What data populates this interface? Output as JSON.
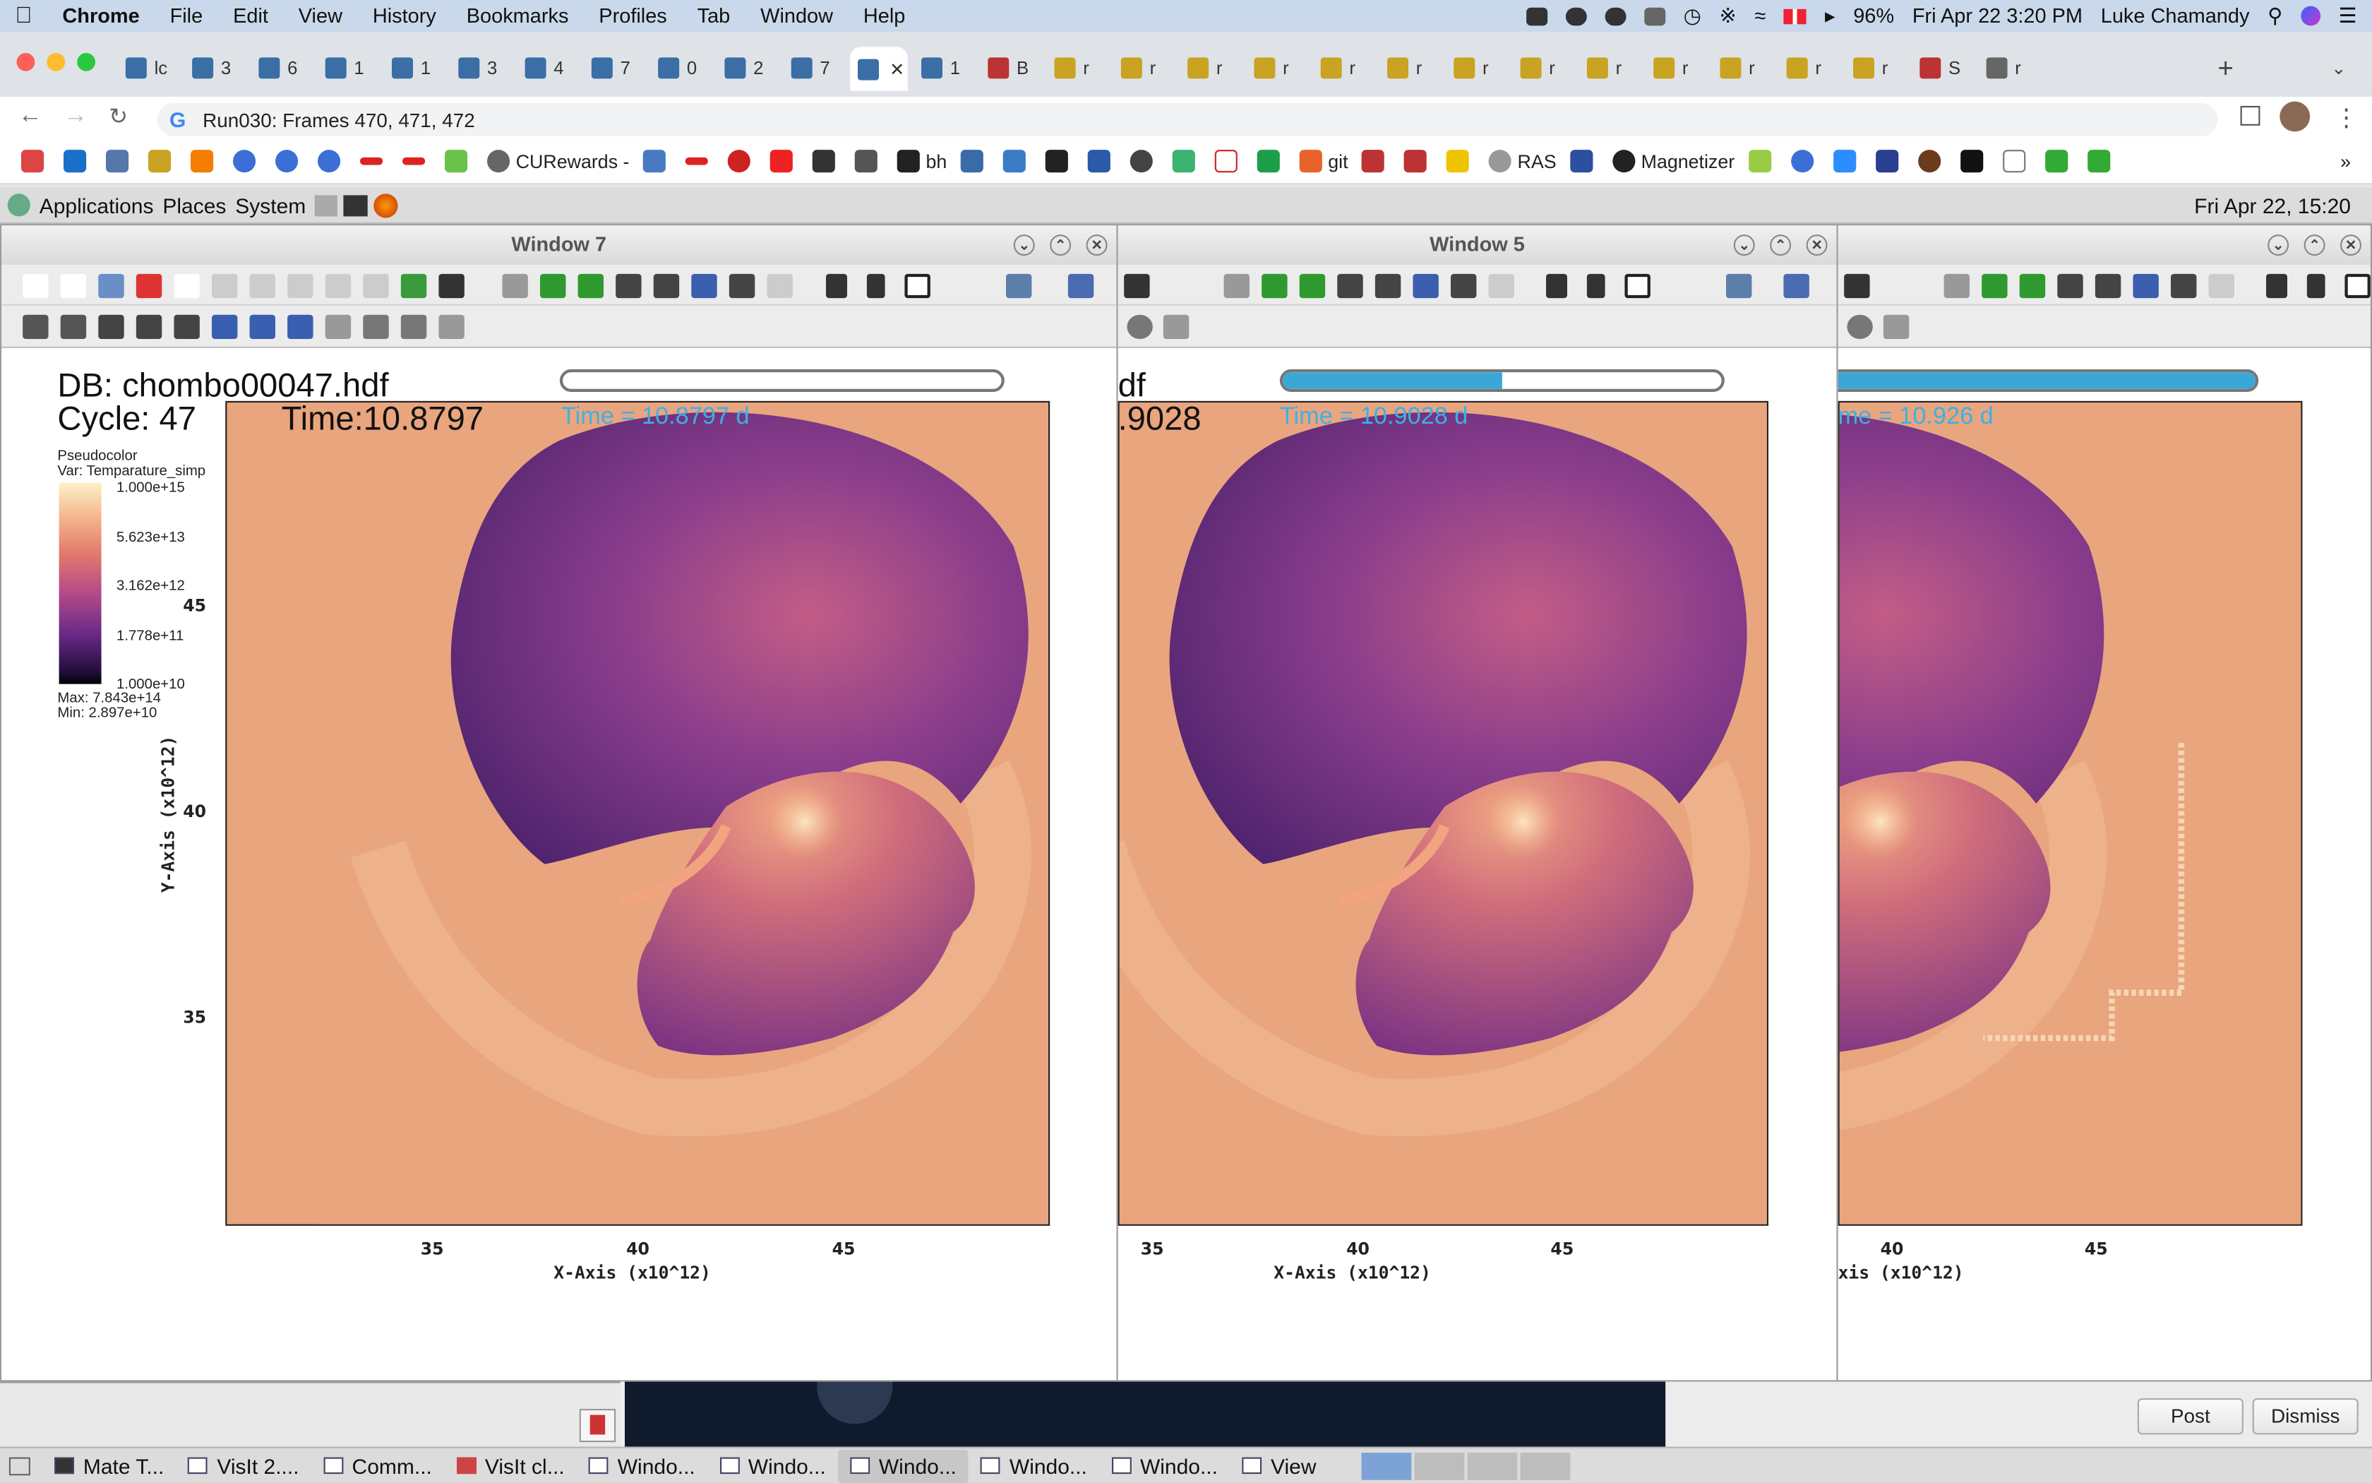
{
  "menubar": {
    "app": "Chrome",
    "items": [
      "File",
      "Edit",
      "View",
      "History",
      "Bookmarks",
      "Profiles",
      "Tab",
      "Window",
      "Help"
    ],
    "battery": "96%",
    "datetime": "Fri Apr 22  3:20 PM",
    "user": "Luke Chamandy"
  },
  "tabs": [
    "lc",
    "3",
    "6",
    "1",
    "1",
    "3",
    "4",
    "7",
    "0",
    "2",
    "7",
    "",
    "1",
    "B",
    "r",
    "r",
    "r",
    "r",
    "r",
    "r",
    "r",
    "r",
    "r",
    "r",
    "r",
    "r",
    "r",
    "S",
    "r"
  ],
  "address": {
    "url": "Run030: Frames 470, 471, 472"
  },
  "bookmarks": {
    "curewards": "CURewards -",
    "bh": "bh",
    "git": "git",
    "ras": "RAS",
    "magnetizer": "Magnetizer"
  },
  "linux_panel": {
    "applications": "Applications",
    "places": "Places",
    "system": "System",
    "clock": "Fri Apr 22, 15:20"
  },
  "windows": [
    {
      "title": "Window 7",
      "db": "DB: chombo00047.hdf",
      "cycle": "Cycle: 47",
      "time_big": "Time:10.8797",
      "time": "Time = 10.8797 d",
      "progress": 0
    },
    {
      "title": "Window 5",
      "db": "df",
      "time_big": ".9028",
      "time": "Time = 10.9028 d",
      "progress": 0.5
    },
    {
      "title": "",
      "time": "me = 10.926 d",
      "progress": 1
    }
  ],
  "legend": {
    "type": "Pseudocolor",
    "var": "Var: Temparature_simp",
    "labels": [
      "1.000e+15",
      "5.623e+13",
      "3.162e+12",
      "1.778e+11",
      "1.000e+10"
    ],
    "max": "Max:  7.843e+14",
    "min": "Min:  2.897e+10"
  },
  "axes": {
    "x_label": "X-Axis (x10^12)",
    "y_label": "Y-Axis (x10^12)",
    "x_ticks": [
      "35",
      "40",
      "45"
    ],
    "y_ticks": [
      "45",
      "40",
      "35"
    ],
    "x_label_partial": "xis (x10^12)"
  },
  "dialog": {
    "post": "Post",
    "dismiss": "Dismiss"
  },
  "taskbar": [
    "Mate T...",
    "VisIt 2....",
    "Comm...",
    "VisIt cl...",
    "Windo...",
    "Windo...",
    "Windo...",
    "Windo...",
    "Windo...",
    "View"
  ],
  "colors": {
    "plot_bg": "#e9a57e",
    "accent": "#3aa7d6",
    "menubar": "#c9d8ea"
  }
}
